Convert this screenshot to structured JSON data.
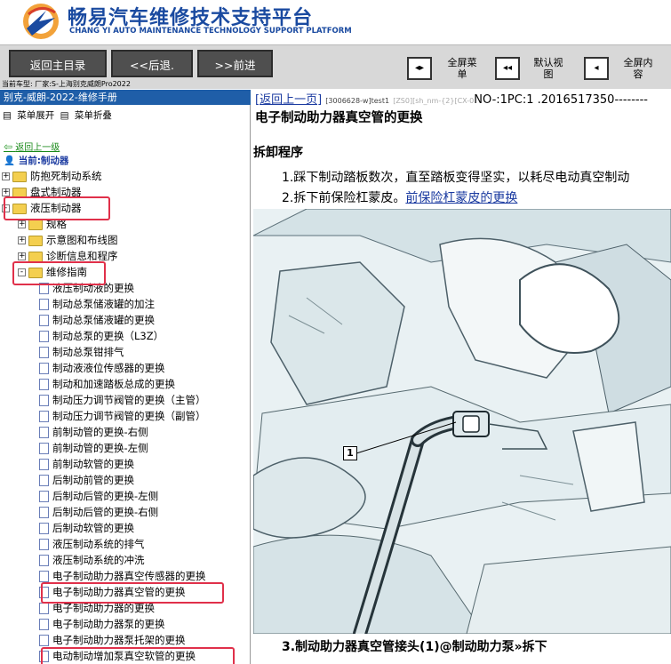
{
  "header": {
    "brand_cn": "畅易汽车维修技术支持平台",
    "brand_en": "CHANG YI AUTO MAINTENANCE TECHNOLOGY SUPPORT PLATFORM",
    "logo_icon": "chang-yi-logo"
  },
  "toolbar": {
    "home_label": "返回主目录",
    "back_label": "<<后退.",
    "forward_label": ">>前进",
    "full_menu_label": "全屏菜单",
    "default_view_label": "默认视图",
    "full_content_label": "全屏内容"
  },
  "car_line": "当前车型:   厂家:S-上海别克威朗Pro2022",
  "sidebar": {
    "manual_title": "别克-威朗-2022-维修手册",
    "expand_label": "菜单展开",
    "collapse_label": "菜单折叠",
    "back_link": "返回上一级",
    "current_label": "当前:制动器",
    "tree": [
      {
        "label": "防抱死制动系统",
        "type": "folder",
        "level": 0,
        "expander": "+"
      },
      {
        "label": "盘式制动器",
        "type": "folder",
        "level": 0,
        "expander": "+"
      },
      {
        "label": "液压制动器",
        "type": "folder",
        "level": 0,
        "expander": "-"
      },
      {
        "label": "规格",
        "type": "folder",
        "level": 1,
        "expander": "+"
      },
      {
        "label": "示意图和布线图",
        "type": "folder",
        "level": 1,
        "expander": "+"
      },
      {
        "label": "诊断信息和程序",
        "type": "folder",
        "level": 1,
        "expander": "+"
      },
      {
        "label": "维修指南",
        "type": "folder",
        "level": 1,
        "expander": "-"
      },
      {
        "label": "液压制动液的更换",
        "type": "page",
        "level": 2
      },
      {
        "label": "制动总泵储液罐的加注",
        "type": "page",
        "level": 2
      },
      {
        "label": "制动总泵储液罐的更换",
        "type": "page",
        "level": 2
      },
      {
        "label": "制动总泵的更换（L3Z）",
        "type": "page",
        "level": 2
      },
      {
        "label": "制动总泵钳排气",
        "type": "page",
        "level": 2
      },
      {
        "label": "制动液液位传感器的更换",
        "type": "page",
        "level": 2
      },
      {
        "label": "制动和加速踏板总成的更换",
        "type": "page",
        "level": 2
      },
      {
        "label": "制动压力调节阀管的更换（主管）",
        "type": "page",
        "level": 2
      },
      {
        "label": "制动压力调节阀管的更换（副管）",
        "type": "page",
        "level": 2
      },
      {
        "label": "前制动管的更换-右侧",
        "type": "page",
        "level": 2
      },
      {
        "label": "前制动管的更换-左侧",
        "type": "page",
        "level": 2
      },
      {
        "label": "前制动软管的更换",
        "type": "page",
        "level": 2
      },
      {
        "label": "后制动前管的更换",
        "type": "page",
        "level": 2
      },
      {
        "label": "后制动后管的更换-左侧",
        "type": "page",
        "level": 2
      },
      {
        "label": "后制动后管的更换-右侧",
        "type": "page",
        "level": 2
      },
      {
        "label": "后制动软管的更换",
        "type": "page",
        "level": 2
      },
      {
        "label": "液压制动系统的排气",
        "type": "page",
        "level": 2
      },
      {
        "label": "液压制动系统的冲洗",
        "type": "page",
        "level": 2
      },
      {
        "label": "电子制动助力器真空传感器的更换",
        "type": "page",
        "level": 2
      },
      {
        "label": "电子制动助力器真空管的更换",
        "type": "page",
        "level": 2
      },
      {
        "label": "电子制动助力器的更换",
        "type": "page",
        "level": 2
      },
      {
        "label": "电子制动助力器泵的更换",
        "type": "page",
        "level": 2
      },
      {
        "label": "电子制动助力器泵托架的更换",
        "type": "page",
        "level": 2
      },
      {
        "label": "电动制动增加泵真空软管的更换",
        "type": "page",
        "level": 2
      }
    ],
    "highlight_color": "#e0304a"
  },
  "document": {
    "back_link": "[返回上一页]",
    "code": "[3006628-w]test1",
    "gray_code": "[ZS0][sh_nm-{2}[CX-0",
    "number_text": "NO-:1PC:1 .2016517350--------",
    "title": "电子制动助力器真空管的更换",
    "section": "拆卸程序",
    "step1": "1.踩下制动踏板数次，直至踏板变得坚实，以耗尽电动真空制动",
    "step2_prefix": "2.拆下前保险杠蒙皮。",
    "step2_link": "前保险杠蒙皮的更换",
    "callout": "1",
    "step3": "3.制动助力器真空管接头(1)@制动助力泵»拆下"
  }
}
